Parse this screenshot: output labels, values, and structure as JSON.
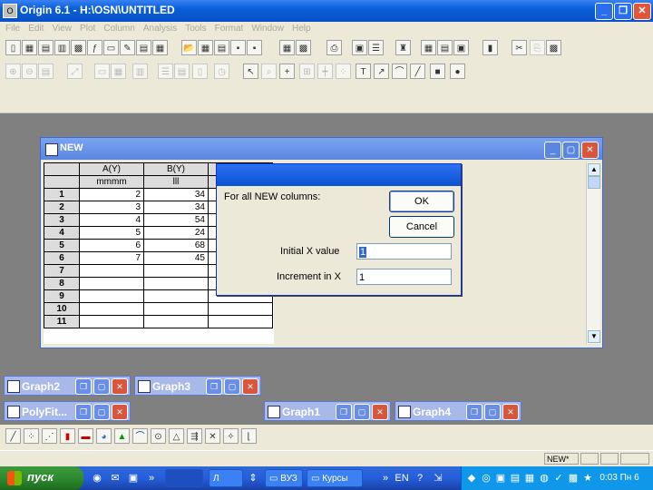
{
  "app": {
    "title": "Origin 6.1 - H:\\OSN\\UNTITLED",
    "icon": "app-icon"
  },
  "menu": [
    "File",
    "Edit",
    "View",
    "Plot",
    "Column",
    "Analysis",
    "Tools",
    "Format",
    "Window",
    "Help"
  ],
  "worksheet": {
    "title": "NEW",
    "columns": [
      {
        "name": "A(Y)",
        "sub": "mmmm"
      },
      {
        "name": "B(Y)",
        "sub": "lll"
      }
    ],
    "rows": [
      {
        "n": "1",
        "a": "2",
        "b": "34"
      },
      {
        "n": "2",
        "a": "3",
        "b": "34"
      },
      {
        "n": "3",
        "a": "4",
        "b": "54"
      },
      {
        "n": "4",
        "a": "5",
        "b": "24"
      },
      {
        "n": "5",
        "a": "6",
        "b": "68"
      },
      {
        "n": "6",
        "a": "7",
        "b": "45"
      },
      {
        "n": "7",
        "a": "",
        "b": ""
      },
      {
        "n": "8",
        "a": "",
        "b": ""
      },
      {
        "n": "9",
        "a": "",
        "b": ""
      },
      {
        "n": "10",
        "a": "",
        "b": ""
      },
      {
        "n": "11",
        "a": "",
        "b": ""
      }
    ]
  },
  "dialog": {
    "prompt": "For all NEW columns:",
    "ok": "OK",
    "cancel": "Cancel",
    "initial_label": "Initial X value",
    "initial_value": "1",
    "increment_label": "Increment in X",
    "increment_value": "1"
  },
  "minimized": [
    "Graph2",
    "Graph3",
    "PolyFit...",
    "Graph1",
    "Graph4"
  ],
  "status": {
    "cell": "NEW*"
  },
  "taskbar": {
    "start": "пуск",
    "buttons": [
      "",
      "Л",
      "ВУЗ",
      "Курсы"
    ],
    "lang": "EN",
    "clock": "0:03 Пн 6"
  }
}
